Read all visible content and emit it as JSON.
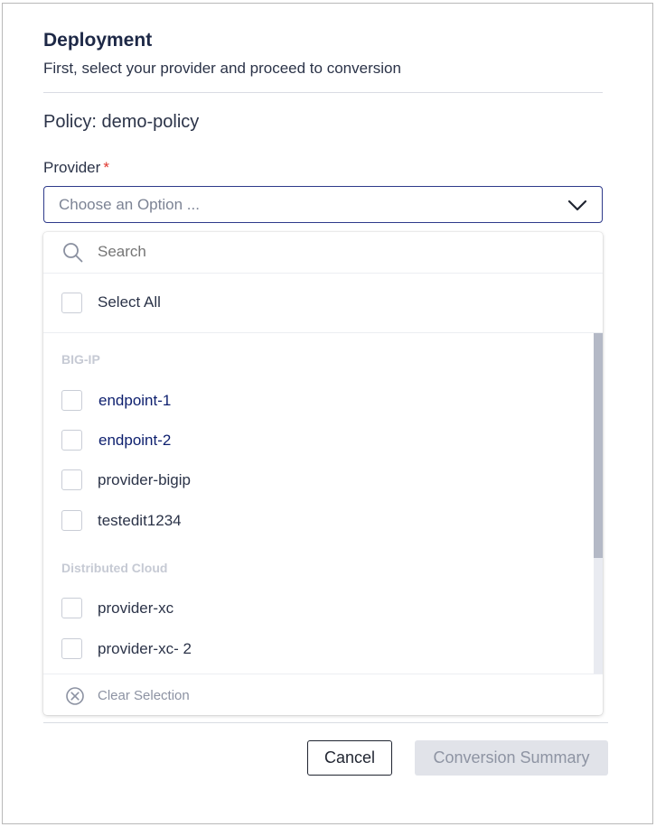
{
  "dialog": {
    "title": "Deployment",
    "subtitle": "First, select your provider and proceed to conversion",
    "policy": "Policy: demo-policy"
  },
  "provider_field": {
    "label": "Provider",
    "required_mark": "*",
    "placeholder": "Choose an Option ...",
    "chevron_icon": "chevron-down-icon"
  },
  "dropdown": {
    "search_placeholder": "Search",
    "search_icon": "search-icon",
    "select_all_label": "Select All",
    "groups": [
      {
        "name": "BIG-IP",
        "options": [
          {
            "label": "endpoint-1",
            "checked": false
          },
          {
            "label": "endpoint-2",
            "checked": false
          },
          {
            "label": "provider-bigip",
            "checked": false
          },
          {
            "label": "testedit1234",
            "checked": false
          }
        ]
      },
      {
        "name": "Distributed Cloud",
        "options": [
          {
            "label": "provider-xc",
            "checked": false
          },
          {
            "label": "provider-xc- 2",
            "checked": false
          }
        ]
      }
    ],
    "clear_label": "Clear Selection",
    "clear_icon": "clear-circle-icon"
  },
  "footer": {
    "cancel_label": "Cancel",
    "summary_label": "Conversion Summary"
  },
  "colors": {
    "accent": "#2e3a8a",
    "title": "#1d2846",
    "required": "#e0362e",
    "disabled_bg": "#e1e3e9"
  }
}
